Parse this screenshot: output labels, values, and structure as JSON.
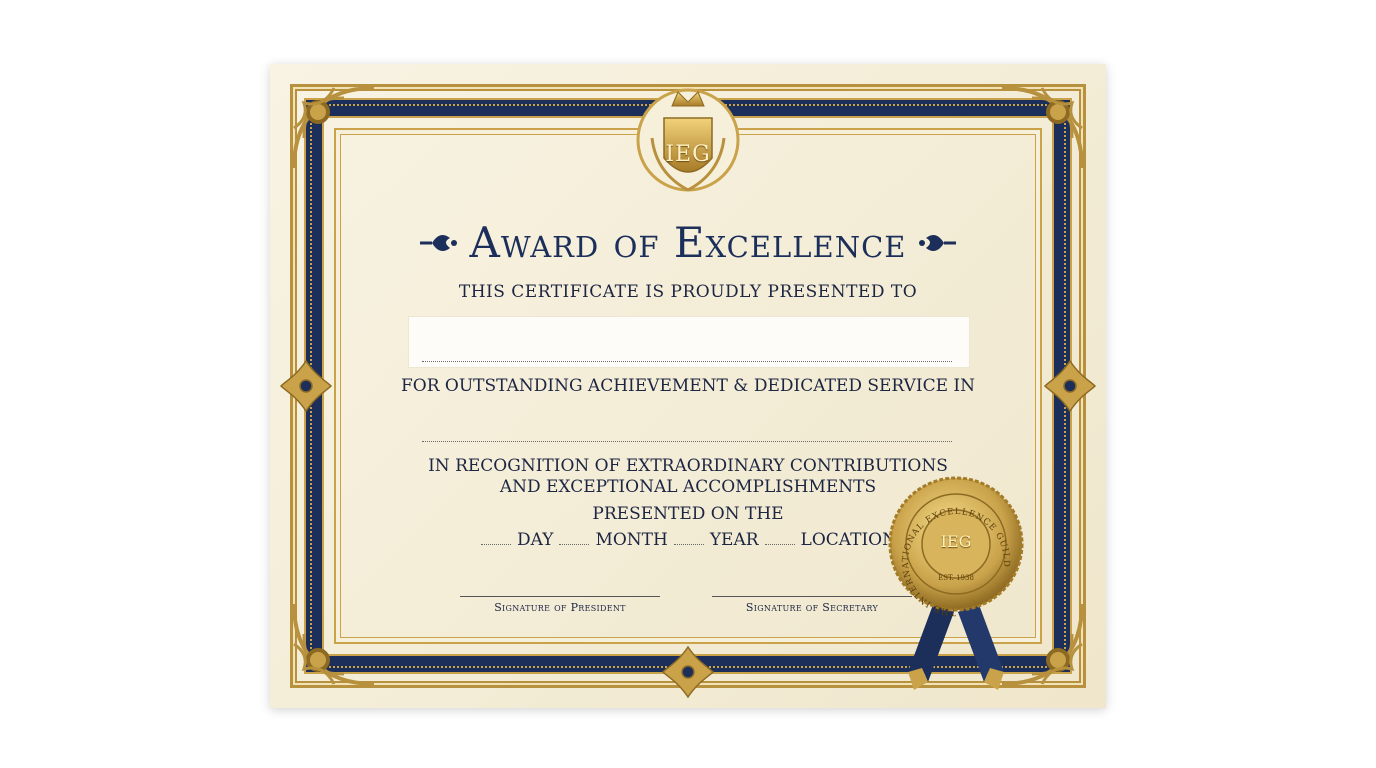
{
  "certificate": {
    "crest_initials": "IEG",
    "title": "Award of Excellence",
    "presented_to": "THIS CERTIFICATE IS PROUDLY PRESENTED TO",
    "recipient_name": "",
    "for_text": "FOR OUTSTANDING ACHIEVEMENT & DEDICATED SERVICE IN",
    "recognition_line_1": "IN RECOGNITION OF EXTRAORDINARY CONTRIBUTIONS",
    "recognition_line_2": "AND EXCEPTIONAL ACCOMPLISHMENTS",
    "presented_on": "PRESENTED ON THE",
    "date_fields": {
      "day": "DAY",
      "month": "MONTH",
      "year": "YEAR",
      "location": "LOCATION"
    },
    "signature_president": "Signature of President",
    "signature_secretary": "Signature of Secretary"
  },
  "seal": {
    "initials": "IEG",
    "ring_text": "THE INTERNATIONAL EXCELLENCE GUILD",
    "est": "EST. 1938"
  },
  "colors": {
    "navy": "#1c2f5a",
    "gold": "#c9a24a",
    "paper": "#f6f0dc"
  }
}
